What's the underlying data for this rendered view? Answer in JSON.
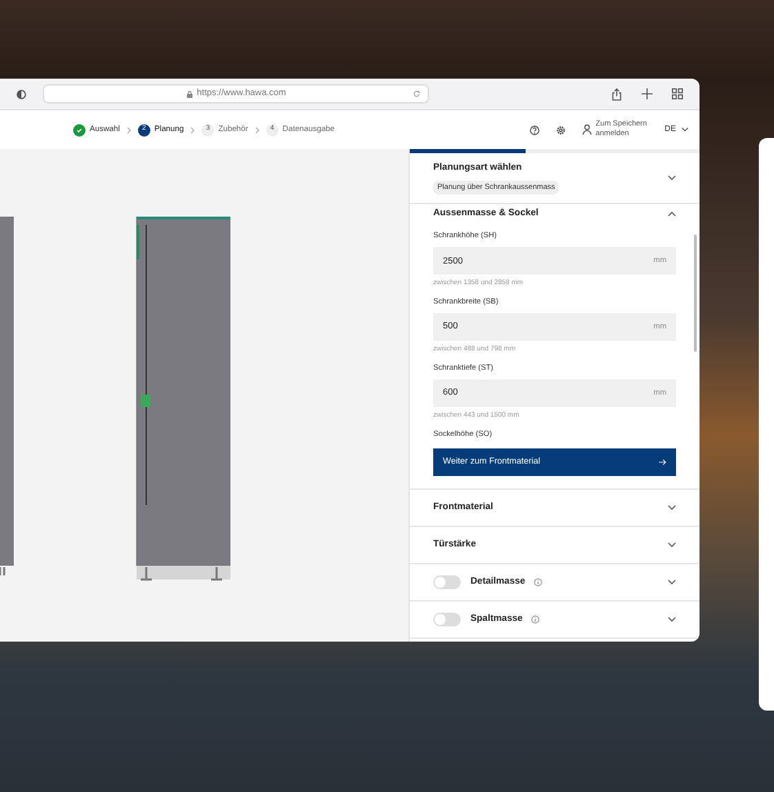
{
  "browser": {
    "url": "https://www.hawa.com"
  },
  "steps": [
    {
      "label": "Auswahl",
      "done": true,
      "selected": false
    },
    {
      "number": "2",
      "label": "Planung",
      "done": false,
      "selected": true
    },
    {
      "number": "3",
      "label": "Zubehör",
      "done": false,
      "selected": false
    },
    {
      "number": "4",
      "label": "Datenausgabe",
      "done": false,
      "selected": false
    }
  ],
  "header": {
    "login": "Zum Speichern anmelden",
    "language": "DE"
  },
  "panel": {
    "progress": {
      "level": 0.4
    },
    "sections": [
      {
        "kind": "select",
        "title": "Planungsart wählen",
        "value": "Planung über Schrankaussenmass",
        "expanded": false
      },
      {
        "kind": "form",
        "title": "Aussenmasse & Sockel",
        "expanded": true,
        "fields": [
          {
            "label": "Schrankhöhe (SH)",
            "value": "2500",
            "unit": "mm",
            "hint": "zwischen 1358 und 2858 mm"
          },
          {
            "label": "Schrankbreite (SB)",
            "value": "500",
            "unit": "mm",
            "hint": "zwischen 488 und 798 mm"
          },
          {
            "label": "Schranktiefe (ST)",
            "value": "600",
            "unit": "mm",
            "hint": "zwischen 443 und 1500 mm"
          },
          {
            "label": "Sockelhöhe (SO)"
          }
        ],
        "button": "Weiter zum Frontmaterial"
      },
      {
        "kind": "plain",
        "title": "Frontmaterial",
        "expanded": false
      },
      {
        "kind": "plain",
        "title": "Türstärke",
        "expanded": false
      },
      {
        "kind": "toggle",
        "title": "Detailmasse",
        "on": false,
        "expanded": false
      },
      {
        "kind": "toggle",
        "title": "Spaltmasse",
        "on": false,
        "expanded": false
      }
    ]
  }
}
